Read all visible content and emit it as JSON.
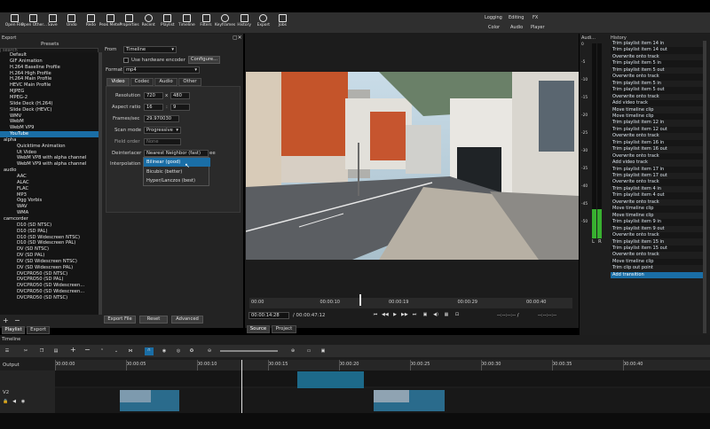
{
  "toolbar": {
    "buttons": [
      {
        "label": "Open File",
        "icon": "folder-icon"
      },
      {
        "label": "Open Other...",
        "icon": "folder-open-icon"
      },
      {
        "label": "Save",
        "icon": "save-icon"
      },
      {
        "label": "Undo",
        "icon": "undo-icon"
      },
      {
        "label": "Redo",
        "icon": "redo-icon"
      },
      {
        "label": "Peak Meter",
        "icon": "peak-meter-icon"
      },
      {
        "label": "Properties",
        "icon": "info-icon"
      },
      {
        "label": "Recent",
        "icon": "clock-icon"
      },
      {
        "label": "Playlist",
        "icon": "list-icon"
      },
      {
        "label": "Timeline",
        "icon": "timeline-icon"
      },
      {
        "label": "Filters",
        "icon": "filter-icon"
      },
      {
        "label": "Keyframes",
        "icon": "stopwatch-icon"
      },
      {
        "label": "History",
        "icon": "history-icon"
      },
      {
        "label": "Export",
        "icon": "export-icon"
      },
      {
        "label": "Jobs",
        "icon": "jobs-icon"
      }
    ],
    "layouts_top": [
      "Logging",
      "Editing",
      "FX"
    ],
    "layouts_bottom": [
      "Color",
      "Audio",
      "Player"
    ]
  },
  "export": {
    "panel_title": "Export",
    "presets_title": "Presets",
    "search_placeholder": "search",
    "presets": [
      {
        "label": "Default",
        "indent": 1
      },
      {
        "label": "GIF Animation",
        "indent": 1
      },
      {
        "label": "H.264 Baseline Profile",
        "indent": 1
      },
      {
        "label": "H.264 High Profile",
        "indent": 1
      },
      {
        "label": "H.264 Main Profile",
        "indent": 1
      },
      {
        "label": "HEVC Main Profile",
        "indent": 1
      },
      {
        "label": "MJPEG",
        "indent": 1
      },
      {
        "label": "MPEG-2",
        "indent": 1
      },
      {
        "label": "Slide Deck (H.264)",
        "indent": 1
      },
      {
        "label": "Slide Deck (HEVC)",
        "indent": 1
      },
      {
        "label": "WMV",
        "indent": 1
      },
      {
        "label": "WebM",
        "indent": 1
      },
      {
        "label": "WebM VP9",
        "indent": 1
      },
      {
        "label": "YouTube",
        "indent": 1,
        "selected": true
      },
      {
        "label": "alpha",
        "indent": 0
      },
      {
        "label": "Quicktime Animation",
        "indent": 2
      },
      {
        "label": "Ut Video",
        "indent": 2
      },
      {
        "label": "WebM VP8 with alpha channel",
        "indent": 2
      },
      {
        "label": "WebM VP9 with alpha channel",
        "indent": 2
      },
      {
        "label": "audio",
        "indent": 0
      },
      {
        "label": "AAC",
        "indent": 2
      },
      {
        "label": "ALAC",
        "indent": 2
      },
      {
        "label": "FLAC",
        "indent": 2
      },
      {
        "label": "MP3",
        "indent": 2
      },
      {
        "label": "Ogg Vorbis",
        "indent": 2
      },
      {
        "label": "WAV",
        "indent": 2
      },
      {
        "label": "WMA",
        "indent": 2
      },
      {
        "label": "camcorder",
        "indent": 0
      },
      {
        "label": "D10 (SD NTSC)",
        "indent": 2
      },
      {
        "label": "D10 (SD PAL)",
        "indent": 2
      },
      {
        "label": "D10 (SD Widescreen NTSC)",
        "indent": 2
      },
      {
        "label": "D10 (SD Widescreen PAL)",
        "indent": 2
      },
      {
        "label": "DV (SD NTSC)",
        "indent": 2
      },
      {
        "label": "DV (SD PAL)",
        "indent": 2
      },
      {
        "label": "DV (SD Widescreen NTSC)",
        "indent": 2
      },
      {
        "label": "DV (SD Widescreen PAL)",
        "indent": 2
      },
      {
        "label": "DVCPRO50 (SD NTSC)",
        "indent": 2
      },
      {
        "label": "DVCPRO50 (SD PAL)",
        "indent": 2
      },
      {
        "label": "DVCPRO50 (SD Widescreen...",
        "indent": 2
      },
      {
        "label": "DVCPRO50 (SD Widescreen...",
        "indent": 2
      },
      {
        "label": "DVCPRO50 (SD NTSC)",
        "indent": 2
      }
    ],
    "add_symbol": "+",
    "remove_symbol": "−",
    "from_label": "From",
    "from_value": "Timeline",
    "hw_encoder_label": "Use hardware encoder",
    "configure_label": "Configure...",
    "format_label": "Format",
    "format_value": "mp4",
    "tabs": [
      "Video",
      "Codec",
      "Audio",
      "Other"
    ],
    "resolution_label": "Resolution",
    "res_w": "720",
    "res_x": "x",
    "res_h": "480",
    "aspect_label": "Aspect ratio",
    "aspect_w": "16",
    "aspect_colon": ":",
    "aspect_h": "9",
    "fps_label": "Frames/sec",
    "fps_value": "29.970030",
    "scan_label": "Scan mode",
    "scan_value": "Progressive",
    "field_order_label": "Field order",
    "field_order_value": "None",
    "deinterlacer_label": "Deinterlacer",
    "deinterlacer_value": "Nearest Neighbor (fast)",
    "deinterlacer_suffix": "ee",
    "interp_label": "Interpolation",
    "interp_options": [
      "Bilinear (good)",
      "Bicubic (better)",
      "Hyper/Lanczos (best)"
    ],
    "interp_selected_index": 0,
    "export_file_label": "Export File",
    "reset_label": "Reset",
    "advanced_label": "Advanced",
    "bottom_tabs": [
      "Playlist",
      "Export"
    ]
  },
  "player": {
    "scrub_ticks": [
      "00:00",
      "00:00:10",
      "00:00:19",
      "00:00:29",
      "00:00:40"
    ],
    "scrub_playhead_fraction": 0.34,
    "position": "00:00:14:28",
    "duration": "/ 00:00:47:12",
    "in_out": "--:--:--:-- /",
    "in_out_right": "--:--:--:--",
    "tabs": [
      "Source",
      "Project"
    ]
  },
  "audio_meter": {
    "title": "Audi...",
    "scale": [
      "0",
      "-5",
      "-10",
      "-15",
      "-20",
      "-25",
      "-30",
      "-35",
      "-40",
      "-45",
      "-50"
    ],
    "channels": [
      "L",
      "R"
    ],
    "level_fraction": 0.15
  },
  "history": {
    "title": "History",
    "items": [
      "Trim playlist item 14 in",
      "Trim playlist item 14 out",
      "Overwrite onto track",
      "Trim playlist item 5 in",
      "Trim playlist item 5 out",
      "Overwrite onto track",
      "Trim playlist item 5 in",
      "Trim playlist item 5 out",
      "Overwrite onto track",
      "Add video track",
      "Move timeline clip",
      "Move timeline clip",
      "Trim playlist item 12 in",
      "Trim playlist item 12 out",
      "Overwrite onto track",
      "Trim playlist item 16 in",
      "Trim playlist item 16 out",
      "Overwrite onto track",
      "Add video track",
      "Trim playlist item 17 in",
      "Trim playlist item 17 out",
      "Overwrite onto track",
      "Trim playlist item 4 in",
      "Trim playlist item 4 out",
      "Overwrite onto track",
      "Move timeline clip",
      "Move timeline clip",
      "Trim playlist item 9 in",
      "Trim playlist item 9 out",
      "Overwrite onto track",
      "Trim playlist item 15 in",
      "Trim playlist item 15 out",
      "Overwrite onto track",
      "Move timeline clip",
      "Trim clip out point",
      "Add transition"
    ],
    "selected_index": 35
  },
  "timeline": {
    "title": "Timeline",
    "ruler": [
      "00:00:00",
      "00:00:05",
      "00:00:10",
      "00:00:15",
      "00:00:20",
      "00:00:25",
      "00:00:30",
      "00:00:35",
      "00:00:40"
    ],
    "tracks": [
      "Output",
      "V2"
    ],
    "playhead_time": "00:00:15"
  }
}
